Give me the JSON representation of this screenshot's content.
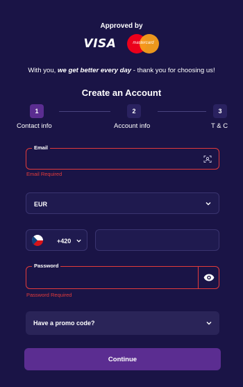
{
  "header": {
    "approved_label": "Approved by",
    "visa_label": "VISA",
    "mastercard_label": "mastercard"
  },
  "tagline": {
    "prefix": "With you, ",
    "emphasis": "we get better every day",
    "suffix": " - thank you for choosing us!"
  },
  "form": {
    "title": "Create an Account",
    "steps": [
      {
        "number": "1",
        "label": "Contact info",
        "active": true
      },
      {
        "number": "2",
        "label": "Account info",
        "active": false
      },
      {
        "number": "3",
        "label": "T & C",
        "active": false
      }
    ],
    "email": {
      "label": "Email",
      "value": "",
      "error": "Email Required"
    },
    "currency": {
      "value": "EUR"
    },
    "phone": {
      "country_code": "+420",
      "value": ""
    },
    "password": {
      "label": "Password",
      "value": "",
      "error": "Password Required"
    },
    "promo": {
      "label": "Have a promo code?"
    },
    "continue_label": "Continue"
  },
  "colors": {
    "background": "#1a1446",
    "accent": "#5b2d91",
    "error": "#e33b3b",
    "field": "#1f1a4f"
  },
  "icons": [
    "scan-icon",
    "chevron-down-icon",
    "czech-flag-icon",
    "eye-icon"
  ]
}
